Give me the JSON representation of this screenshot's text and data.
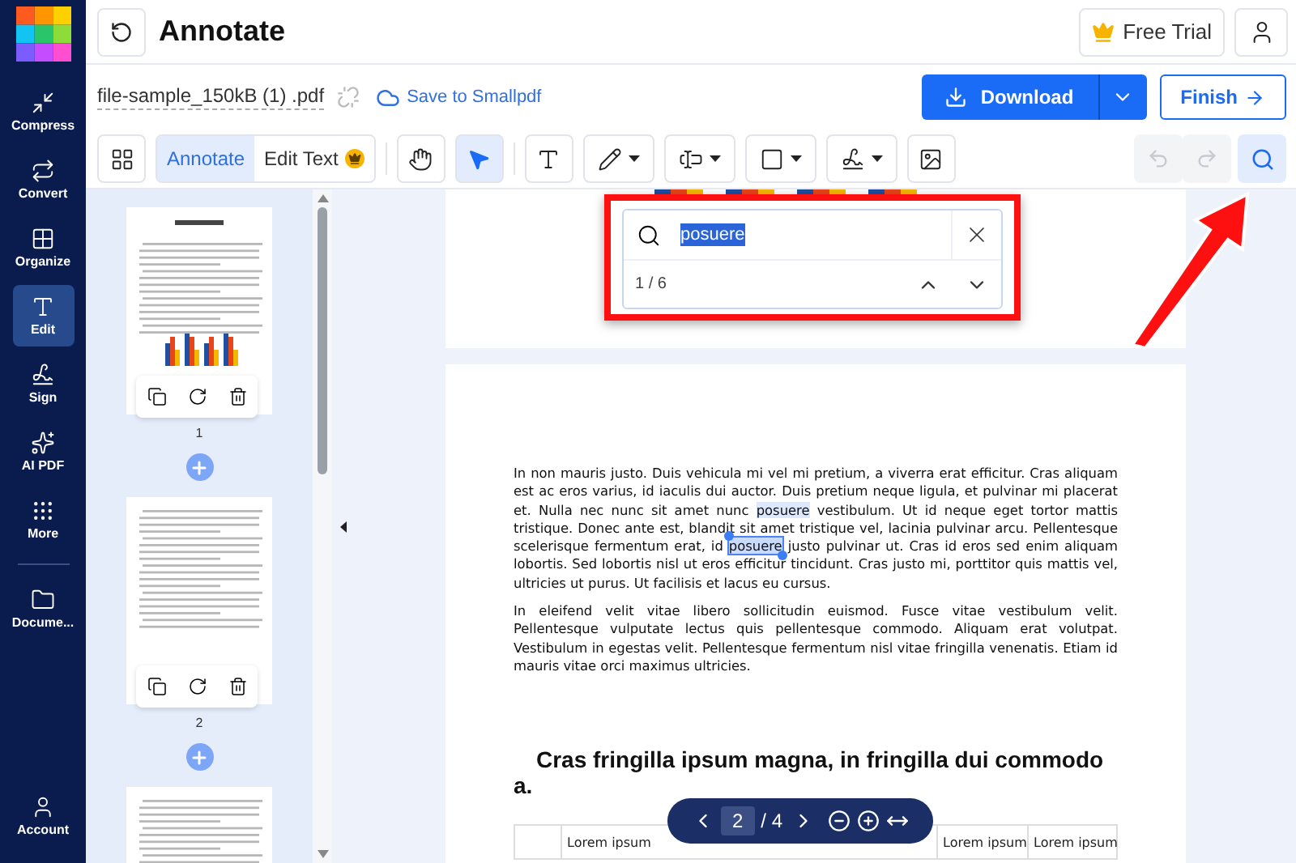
{
  "nav": {
    "items": [
      {
        "label": "Compress",
        "selected": false
      },
      {
        "label": "Convert",
        "selected": false
      },
      {
        "label": "Organize",
        "selected": false
      },
      {
        "label": "Edit",
        "selected": true
      },
      {
        "label": "Sign",
        "selected": false
      },
      {
        "label": "AI PDF",
        "selected": false
      },
      {
        "label": "More",
        "selected": false
      }
    ],
    "documents": {
      "label": "Docume..."
    },
    "account": {
      "label": "Account"
    }
  },
  "header": {
    "title": "Annotate",
    "trial": "Free Trial"
  },
  "file": {
    "name": "file-sample_150kB (1) .pdf",
    "save_link": "Save to Smallpdf",
    "download": "Download",
    "finish": "Finish"
  },
  "toolbar": {
    "modes": [
      {
        "label": "Annotate",
        "selected": true,
        "premium": false
      },
      {
        "label": "Edit Text",
        "selected": false,
        "premium": true
      }
    ],
    "tools": [
      {
        "selected": false,
        "dropdown": false
      },
      {
        "selected": true,
        "dropdown": false
      },
      {
        "selected": false,
        "dropdown": false
      },
      {
        "selected": false,
        "dropdown": true
      },
      {
        "selected": false,
        "dropdown": true
      },
      {
        "selected": false,
        "dropdown": true
      },
      {
        "selected": false,
        "dropdown": true
      },
      {
        "selected": false,
        "dropdown": false
      }
    ],
    "history": [
      {
        "disabled": true
      },
      {
        "disabled": true
      }
    ],
    "search_selected": true
  },
  "thumbnails": [
    {
      "number": "1",
      "selected": false
    },
    {
      "number": "2",
      "selected": false
    }
  ],
  "search": {
    "value": "posuere",
    "count": "1 / 6"
  },
  "document": {
    "paragraphs": [
      [
        {
          "text": "In non mauris justo. Duis vehicula mi vel mi pretium, a viverra erat efficitur. Cras aliquam est ac eros varius, id iaculis dui auctor. Duis pretium neque ligula, et pulvinar mi placerat et. Nulla nec nunc sit amet nunc ",
          "highlighted": false,
          "current": false
        },
        {
          "text": "posuere",
          "highlighted": true,
          "current": false
        },
        {
          "text": " vestibulum. Ut id neque eget tortor mattis tristique. Donec ante est, blandit sit amet tristique vel, lacinia pulvinar arcu. Pellentesque scelerisque fermentum erat, id ",
          "highlighted": false,
          "current": false
        },
        {
          "text": "posuere",
          "highlighted": true,
          "current": true
        },
        {
          "text": " justo pulvinar ut. Cras id eros sed enim aliquam lobortis. Sed lobortis nisl ut eros efficitur tincidunt. Cras justo mi, porttitor quis mattis vel, ultricies ut purus. Ut facilisis et lacus eu cursus.",
          "highlighted": false,
          "current": false
        }
      ],
      [
        {
          "text": "In eleifend velit vitae libero sollicitudin euismod. Fusce vitae vestibulum velit. Pellentesque vulputate lectus quis pellentesque commodo. Aliquam erat volutpat. Vestibulum in egestas velit. Pellentesque fermentum nisl vitae fringilla venenatis. Etiam id mauris vitae orci maximus ultricies.",
          "highlighted": false,
          "current": false
        }
      ]
    ],
    "heading": "Cras fringilla ipsum magna, in fringilla dui commodo a.",
    "table_row": [
      "Lorem ipsum",
      "Lorem ipsum",
      "Lorem ipsum"
    ]
  },
  "pager": {
    "page": "2",
    "total": "/ 4"
  }
}
